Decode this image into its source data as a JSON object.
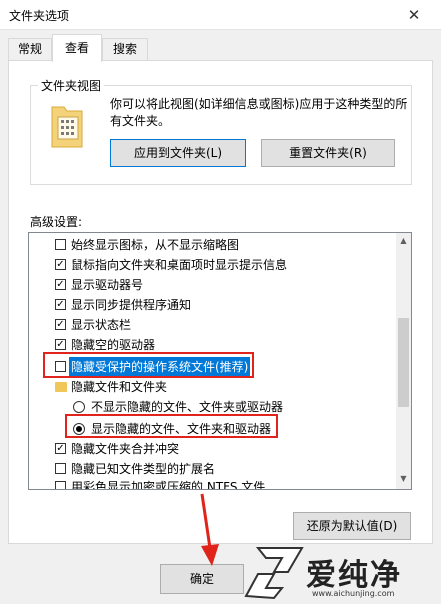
{
  "window": {
    "title": "文件夹选项"
  },
  "tabs": [
    {
      "label": "常规"
    },
    {
      "label": "查看"
    },
    {
      "label": "搜索"
    }
  ],
  "folder_views": {
    "legend": "文件夹视图",
    "description": "你可以将此视图(如详细信息或图标)应用于这种类型的所有文件夹。",
    "apply_button": "应用到文件夹(L)",
    "reset_button": "重置文件夹(R)"
  },
  "advanced": {
    "label": "高级设置:",
    "items": [
      {
        "type": "checkbox",
        "checked": false,
        "label": "始终显示图标，从不显示缩略图"
      },
      {
        "type": "checkbox",
        "checked": true,
        "label": "鼠标指向文件夹和桌面项时显示提示信息"
      },
      {
        "type": "checkbox",
        "checked": true,
        "label": "显示驱动器号"
      },
      {
        "type": "checkbox",
        "checked": true,
        "label": "显示同步提供程序通知"
      },
      {
        "type": "checkbox",
        "checked": true,
        "label": "显示状态栏"
      },
      {
        "type": "checkbox",
        "checked": true,
        "label": "隐藏空的驱动器"
      },
      {
        "type": "checkbox",
        "checked": false,
        "label": "隐藏受保护的操作系统文件(推荐)"
      },
      {
        "type": "folder",
        "label": "隐藏文件和文件夹"
      },
      {
        "type": "radio",
        "checked": false,
        "label": "不显示隐藏的文件、文件夹或驱动器"
      },
      {
        "type": "radio",
        "checked": true,
        "label": "显示隐藏的文件、文件夹和驱动器"
      },
      {
        "type": "checkbox",
        "checked": true,
        "label": "隐藏文件夹合并冲突"
      },
      {
        "type": "checkbox",
        "checked": false,
        "label": "隐藏已知文件类型的扩展名"
      },
      {
        "type": "checkbox",
        "checked": false,
        "label": "用彩色显示加密或压缩的 NTFS 文件"
      }
    ],
    "restore_button": "还原为默认值(D)"
  },
  "footer": {
    "ok_button": "确定"
  },
  "watermark": {
    "brand": "爱纯净",
    "url": "www.aichunjing.com"
  },
  "colors": {
    "highlight": "#0078d7",
    "annotation_red": "#e0241c"
  }
}
